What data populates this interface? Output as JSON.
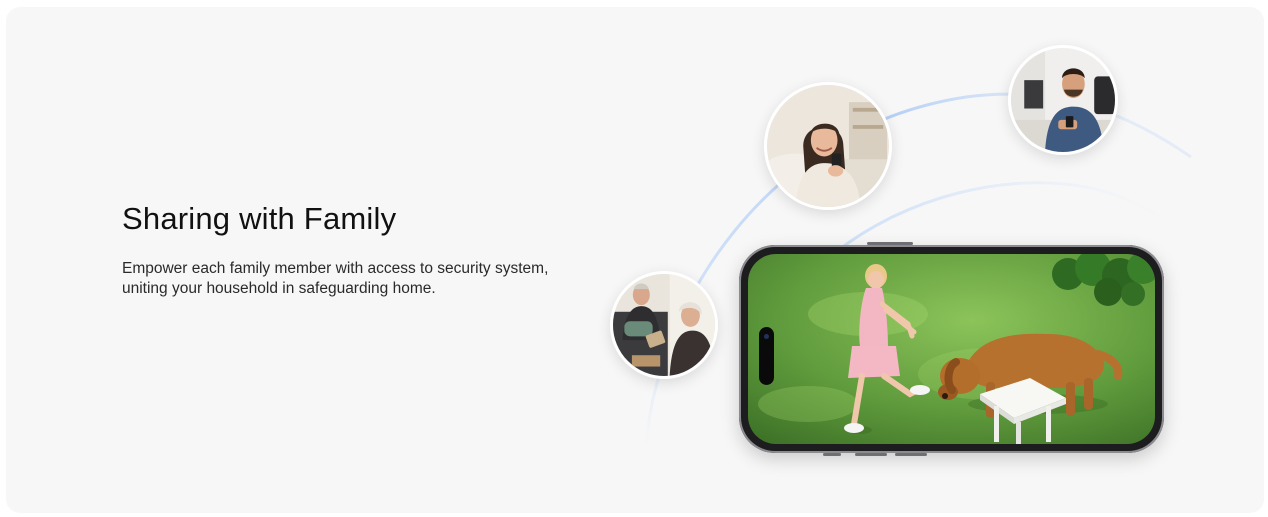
{
  "section": {
    "title": "Sharing with Family",
    "description": "Empower each family member with access to security system, uniting your household in safeguarding home."
  },
  "illustration": {
    "avatars": [
      {
        "name": "avatar-woman-on-couch-with-phone"
      },
      {
        "name": "avatar-man-at-desk-with-phone"
      },
      {
        "name": "avatar-elderly-couple-with-tablet"
      }
    ],
    "phone_screen": "camera-view-girl-playing-with-dog",
    "colors": {
      "card_background": "#f7f7f7",
      "arc_color": "#b9d3f7",
      "grass": "#5f9a3c",
      "phone_frame": "#1d1d1f"
    }
  }
}
